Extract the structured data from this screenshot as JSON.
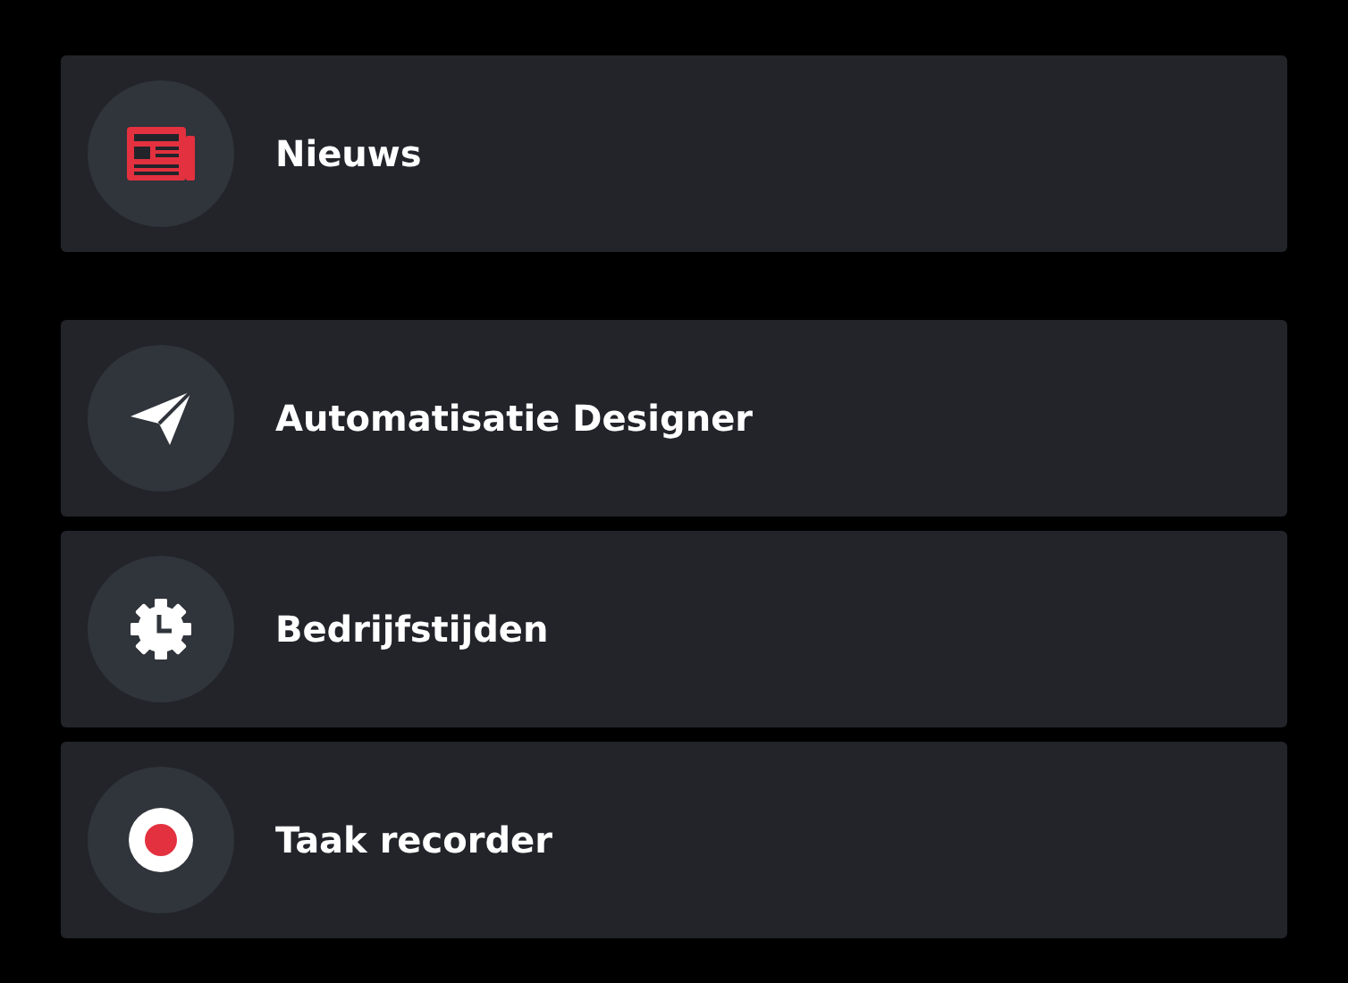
{
  "groups": [
    {
      "items": [
        {
          "kind": "news",
          "label": "Nieuws"
        }
      ]
    },
    {
      "items": [
        {
          "kind": "plane",
          "label": "Automatisatie Designer"
        },
        {
          "kind": "clock",
          "label": "Bedrijfstijden"
        },
        {
          "kind": "record",
          "label": "Taak recorder"
        }
      ]
    }
  ]
}
